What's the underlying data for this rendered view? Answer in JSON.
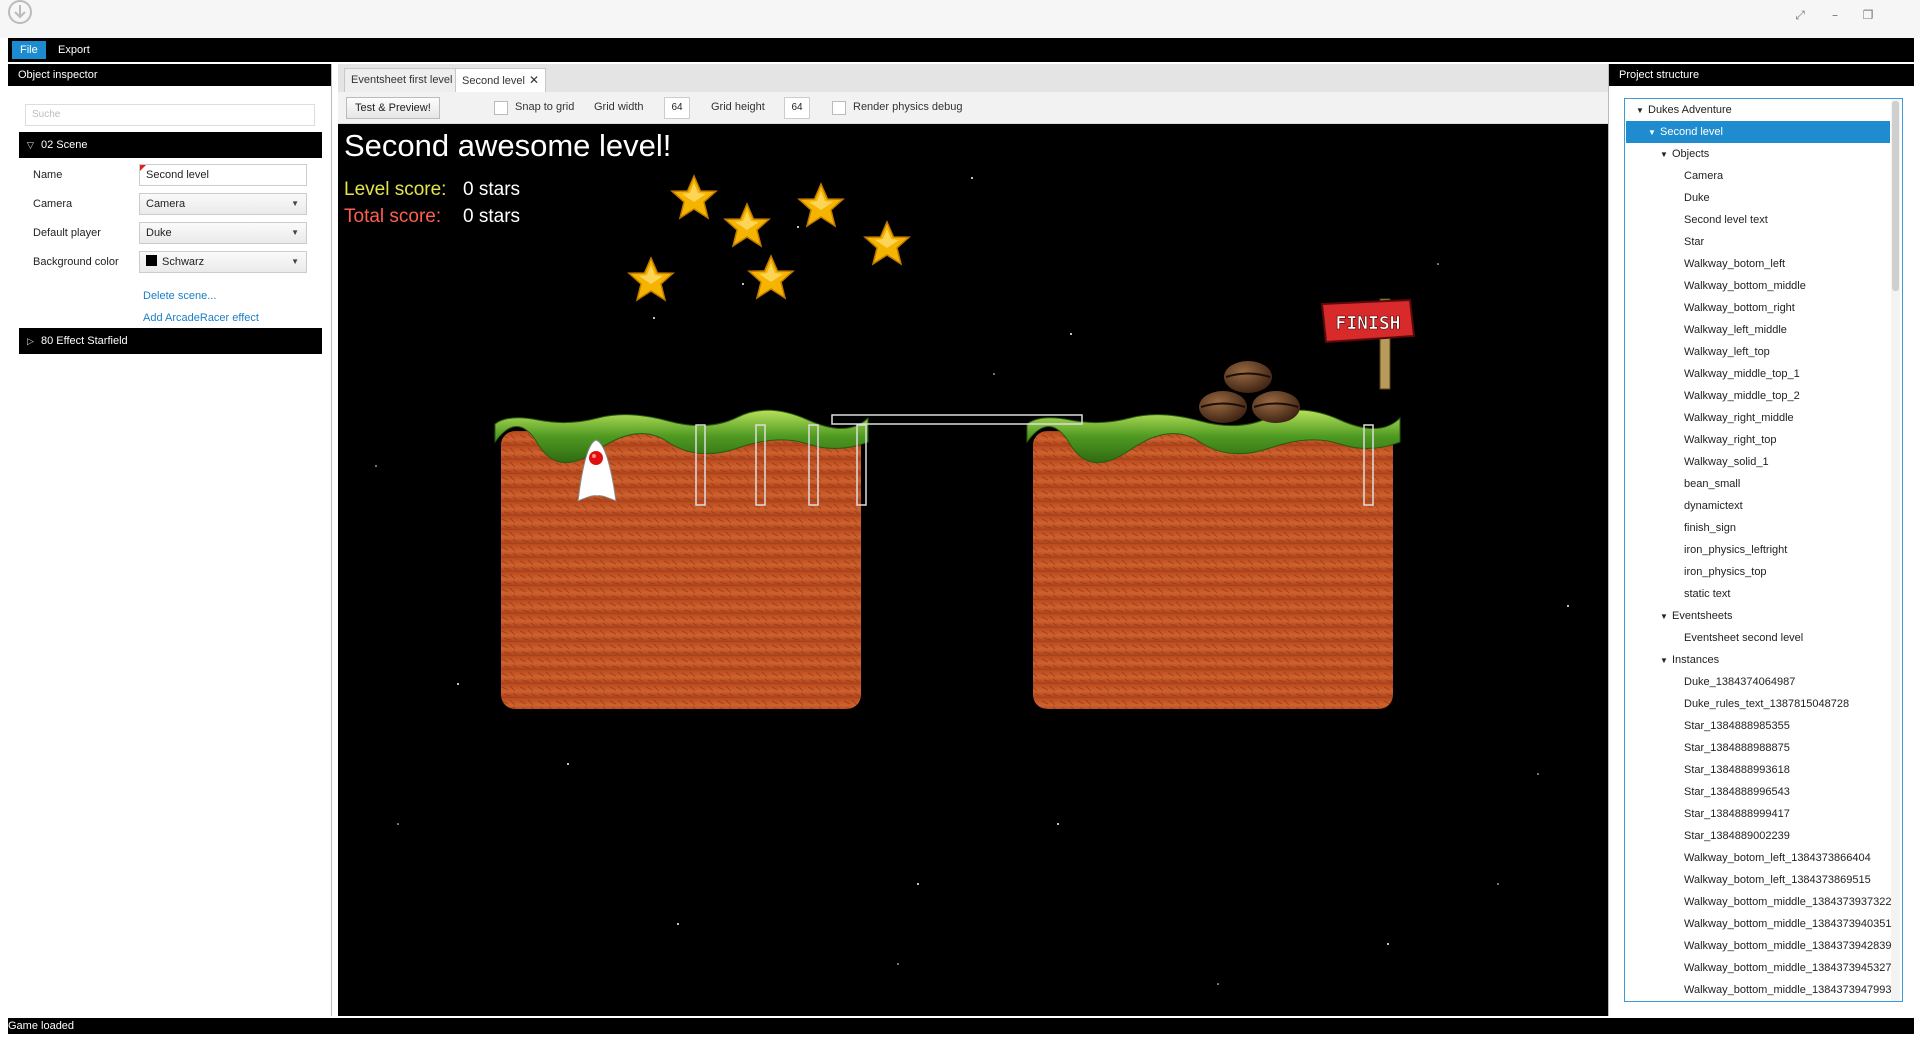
{
  "window": {
    "app_icon": "download-circle-icon",
    "controls": [
      "expand-icon",
      "minimize-icon",
      "restore-icon"
    ]
  },
  "menu": {
    "items": [
      "File",
      "Export"
    ]
  },
  "inspector": {
    "header": "Object inspector",
    "search_placeholder": "Suche",
    "scene_section": "02 Scene",
    "name_label": "Name",
    "name_value": "Second level",
    "camera_label": "Camera",
    "camera_value": "Camera",
    "player_label": "Default player",
    "player_value": "Duke",
    "bg_label": "Background color",
    "bg_value": "Schwarz",
    "delete_link": "Delete scene...",
    "effect_link": "Add ArcadeRacer effect",
    "effect_section": "80 Effect Starfield"
  },
  "tabs": [
    {
      "label": "Eventsheet first level"
    },
    {
      "label": "Second level"
    }
  ],
  "toolbar": {
    "preview_button": "Test & Preview!",
    "snap_label": "Snap to grid",
    "grid_width_label": "Grid width",
    "grid_width_value": "64",
    "grid_height_label": "Grid height",
    "grid_height_value": "64",
    "physics_label": "Render physics debug"
  },
  "stage": {
    "title": "Second awesome level!",
    "level_label": "Level score:",
    "level_value": "0 stars",
    "total_label": "Total score:",
    "total_value": "0 stars",
    "finish_sign": "FINISH",
    "colors": {
      "level_label": "#e5e34a",
      "total_label": "#ff5f4f",
      "dirt": "#c9582a",
      "grass": "#5aa02a"
    }
  },
  "project": {
    "header": "Project structure",
    "tree": [
      {
        "label": "Dukes Adventure",
        "level": 0,
        "expander": "open"
      },
      {
        "label": "Second level",
        "level": 1,
        "expander": "open",
        "selected": true
      },
      {
        "label": "Objects",
        "level": 2,
        "expander": "open"
      },
      {
        "label": "Camera",
        "level": 3
      },
      {
        "label": "Duke",
        "level": 3
      },
      {
        "label": "Second level text",
        "level": 3
      },
      {
        "label": "Star",
        "level": 3
      },
      {
        "label": "Walkway_botom_left",
        "level": 3
      },
      {
        "label": "Walkway_bottom_middle",
        "level": 3
      },
      {
        "label": "Walkway_bottom_right",
        "level": 3
      },
      {
        "label": "Walkway_left_middle",
        "level": 3
      },
      {
        "label": "Walkway_left_top",
        "level": 3
      },
      {
        "label": "Walkway_middle_top_1",
        "level": 3
      },
      {
        "label": "Walkway_middle_top_2",
        "level": 3
      },
      {
        "label": "Walkway_right_middle",
        "level": 3
      },
      {
        "label": "Walkway_right_top",
        "level": 3
      },
      {
        "label": "Walkway_solid_1",
        "level": 3
      },
      {
        "label": "bean_small",
        "level": 3
      },
      {
        "label": "dynamictext",
        "level": 3
      },
      {
        "label": "finish_sign",
        "level": 3
      },
      {
        "label": "iron_physics_leftright",
        "level": 3
      },
      {
        "label": "iron_physics_top",
        "level": 3
      },
      {
        "label": "static text",
        "level": 3
      },
      {
        "label": "Eventsheets",
        "level": 2,
        "expander": "open"
      },
      {
        "label": "Eventsheet second level",
        "level": 3
      },
      {
        "label": "Instances",
        "level": 2,
        "expander": "open"
      },
      {
        "label": "Duke_1384374064987",
        "level": 3
      },
      {
        "label": "Duke_rules_text_1387815048728",
        "level": 3
      },
      {
        "label": "Star_1384888985355",
        "level": 3
      },
      {
        "label": "Star_1384888988875",
        "level": 3
      },
      {
        "label": "Star_1384888993618",
        "level": 3
      },
      {
        "label": "Star_1384888996543",
        "level": 3
      },
      {
        "label": "Star_1384888999417",
        "level": 3
      },
      {
        "label": "Star_1384889002239",
        "level": 3
      },
      {
        "label": "Walkway_botom_left_1384373866404",
        "level": 3
      },
      {
        "label": "Walkway_botom_left_1384373869515",
        "level": 3
      },
      {
        "label": "Walkway_bottom_middle_1384373937322",
        "level": 3
      },
      {
        "label": "Walkway_bottom_middle_1384373940351",
        "level": 3
      },
      {
        "label": "Walkway_bottom_middle_1384373942839",
        "level": 3
      },
      {
        "label": "Walkway_bottom_middle_1384373945327",
        "level": 3
      },
      {
        "label": "Walkway_bottom_middle_1384373947993",
        "level": 3
      }
    ]
  },
  "status": {
    "text": "Game loaded"
  }
}
